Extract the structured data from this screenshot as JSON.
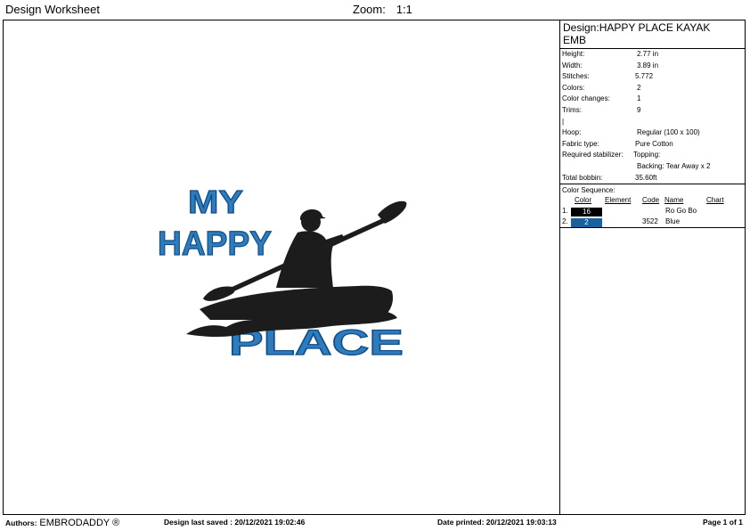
{
  "header": {
    "title": "Design Worksheet",
    "zoom_label": "Zoom:",
    "zoom_value": "1:1"
  },
  "design": {
    "label": "Design:",
    "name_line1": "HAPPY PLACE KAYAK",
    "name_line2": "EMB",
    "height_label": "Height:",
    "height": "2.77 in",
    "width_label": "Width:",
    "width": "3.89 in",
    "stitches_label": "Stitches:",
    "stitches": "5.772",
    "colors_label": "Colors:",
    "colors": "2",
    "color_changes_label": "Color changes:",
    "color_changes": "1",
    "trims_label": "Trims:",
    "trims": "9",
    "blank_mark": "|",
    "hoop_label": "Hoop:",
    "hoop": "Regular (100 x 100)",
    "fabric_label": "Fabric type:",
    "fabric": "Pure Cotton",
    "stabilizer_label": "Required stabilizer:",
    "topping": "Topping:",
    "backing": "Backing: Tear Away x 2",
    "bobbin_label": "Total bobbin:",
    "bobbin": "35.60ft"
  },
  "color_sequence": {
    "title": "Color Sequence:",
    "headers": {
      "color": "Color",
      "element": "Element",
      "code": "Code",
      "name": "Name",
      "chart": "Chart"
    },
    "rows": [
      {
        "idx": "1.",
        "swatch_label": "16",
        "swatch_color": "#000000",
        "code": "",
        "name": "Ro Go Bo"
      },
      {
        "idx": "2.",
        "swatch_label": "2",
        "swatch_color": "#1a5f9e",
        "code": "3522",
        "name": "Blue"
      }
    ]
  },
  "artwork": {
    "line1": "MY",
    "line2": "HAPPY",
    "line3": "PLACE",
    "text_color": "#2e7bbd",
    "silhouette_color": "#1c1c1c"
  },
  "footer": {
    "authors_label": "Authors:",
    "authors_value": "EMBRODADDY ®",
    "saved_label": "Design last saved :",
    "saved": "20/12/2021 19:02:46",
    "printed_label": "Date printed:",
    "printed": "20/12/2021 19:03:13",
    "page": "Page 1 of 1"
  }
}
